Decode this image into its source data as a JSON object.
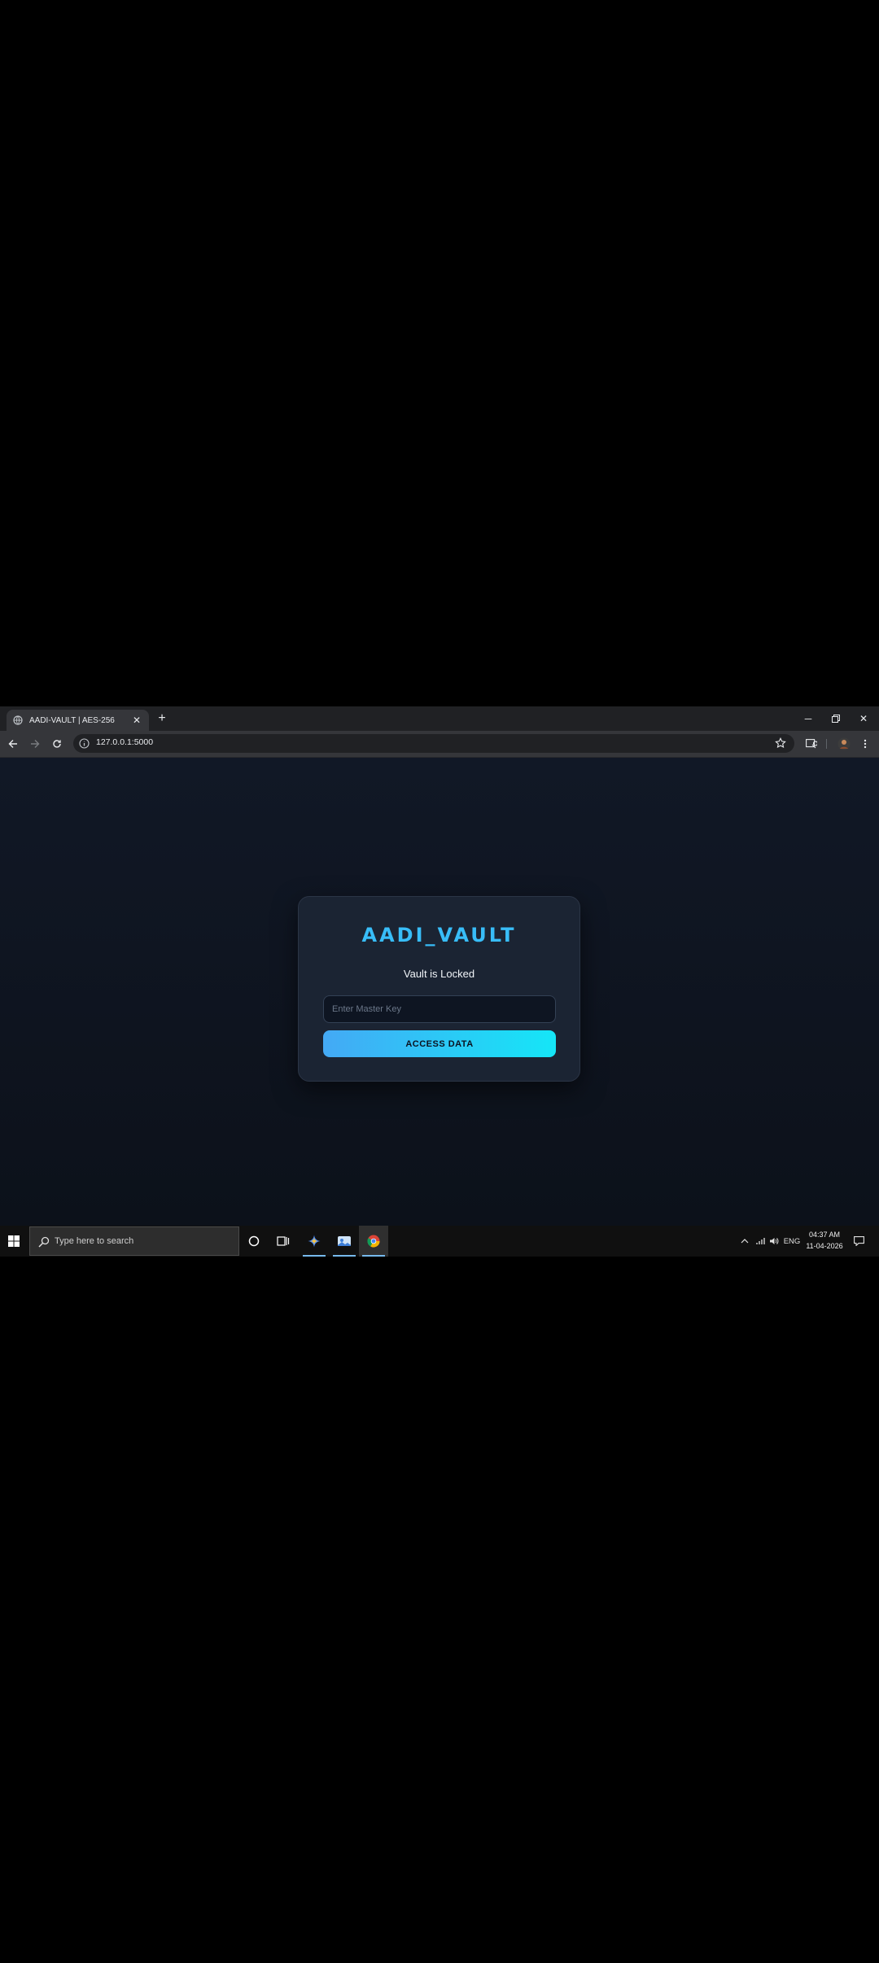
{
  "browser": {
    "tab_title": "AADI-VAULT | AES-256",
    "new_tab_label": "+",
    "url": "127.0.0.1:5000"
  },
  "page": {
    "app_title": "AADI_VAULT",
    "status": "Vault is Locked",
    "master_key_placeholder": "Enter Master Key",
    "access_button": "ACCESS DATA"
  },
  "taskbar": {
    "search_placeholder": "Type here to search",
    "language": "ENG",
    "time": "04:37 AM",
    "date": "11-04-2026"
  },
  "colors": {
    "accent": "#38bdf8",
    "button_gradient_start": "#44a9f5",
    "button_gradient_end": "#15e6f7",
    "card_background": "#1b2433",
    "page_background": "#0c111a"
  }
}
